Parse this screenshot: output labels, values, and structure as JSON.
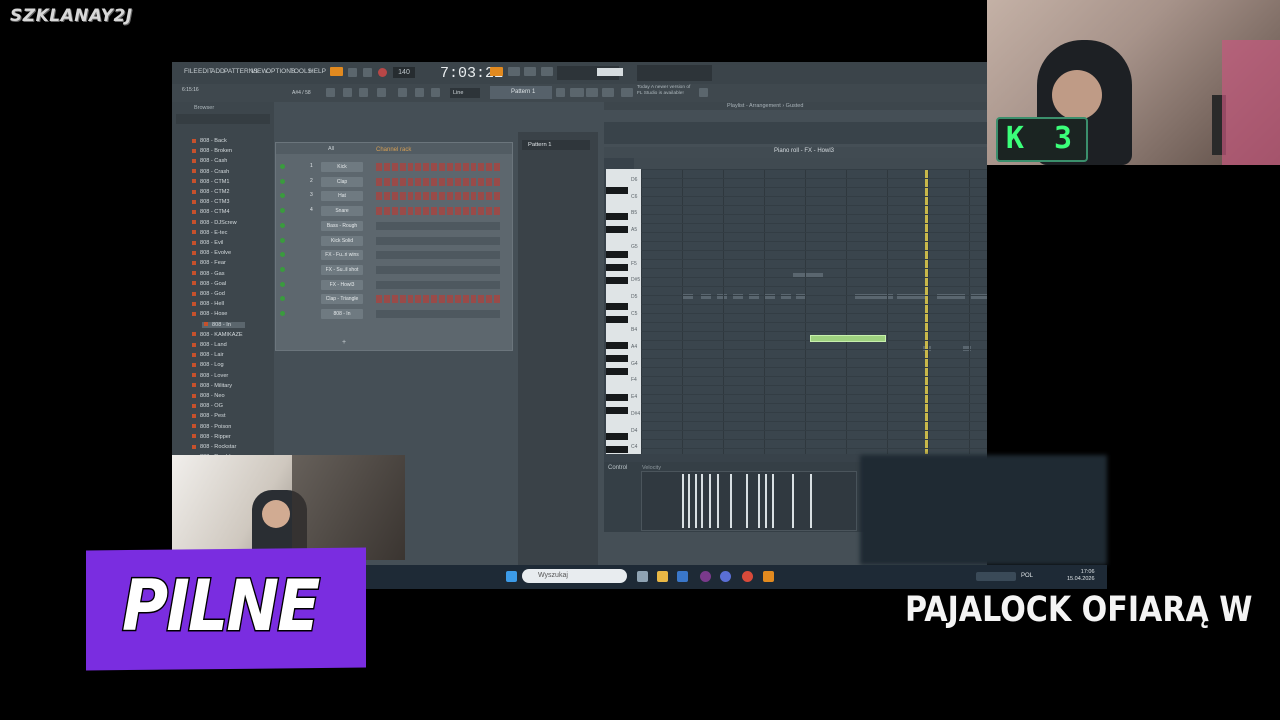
{
  "watermark": "SZKLANAY2J",
  "fl": {
    "menu": [
      "FILE",
      "EDIT",
      "ADD",
      "PATTERNS",
      "VIEW",
      "OPTIONS",
      "TOOLS",
      "HELP"
    ],
    "time": "7:03:21",
    "tempo": "140",
    "pattern": "Pattern 1",
    "pattern_selector": "Pattern 1",
    "snap": "Line",
    "notify_line1": "Today  A newer version of",
    "notify_line2": "FL Studio is available!",
    "hint_left": "6:15:16",
    "hint_right": "A#4 / 58",
    "browser_title": "Browser",
    "browser_items": [
      "808 - Back",
      "808 - Broken",
      "808 - Cash",
      "808 - Crash",
      "808 - CTM1",
      "808 - CTM2",
      "808 - CTM3",
      "808 - CTM4",
      "808 - DJScrew",
      "808 - E-tec",
      "808 - Evil",
      "808 - Evolve",
      "808 - Fear",
      "808 - Gas",
      "808 - Goal",
      "808 - God",
      "808 - Hell",
      "808 - Hose",
      "808 - In",
      "808 - KAMIKAZE",
      "808 - Land",
      "808 - Lair",
      "808 - Log",
      "808 - Lover",
      "808 - Military",
      "808 - Neo",
      "808 - OG",
      "808 - Pest",
      "808 - Poison",
      "808 - Ripper",
      "808 - Rockstar",
      "808 - Rumble"
    ],
    "rack_title": "Channel rack",
    "rack_filter": "All",
    "channels": [
      {
        "num": "1",
        "name": "Kick"
      },
      {
        "num": "2",
        "name": "Clap"
      },
      {
        "num": "3",
        "name": "Hat"
      },
      {
        "num": "4",
        "name": "Snare"
      },
      {
        "num": "",
        "name": "Bass - Rough"
      },
      {
        "num": "",
        "name": "Kick Solid"
      },
      {
        "num": "",
        "name": "FX - Fu..ri wins"
      },
      {
        "num": "",
        "name": "FX - Su..il shot"
      },
      {
        "num": "",
        "name": "FX - Howl3"
      },
      {
        "num": "",
        "name": "Clap - Triangle"
      },
      {
        "num": "",
        "name": "808 - In"
      }
    ],
    "playlist_title": "Playlist - Arrangement › Gusted",
    "piano_roll_title": "Piano roll - FX - Howl3",
    "key_labels": [
      "D6",
      "C6",
      "B5",
      "A5",
      "G5",
      "F5",
      "D#5",
      "D5",
      "C5",
      "B4",
      "A4",
      "G4",
      "F4",
      "E4",
      "D#4",
      "D4",
      "C4"
    ],
    "control_label": "Control",
    "control_value": "Velocity"
  },
  "taskbar": {
    "search_placeholder": "Wyszukaj",
    "lang": "POL",
    "time": "17:06",
    "date": "15.04.2026"
  },
  "overlay": {
    "k3": "K 3",
    "pilne": "PILNE",
    "ticker": "PAJALOCK OFIARĄ W"
  }
}
